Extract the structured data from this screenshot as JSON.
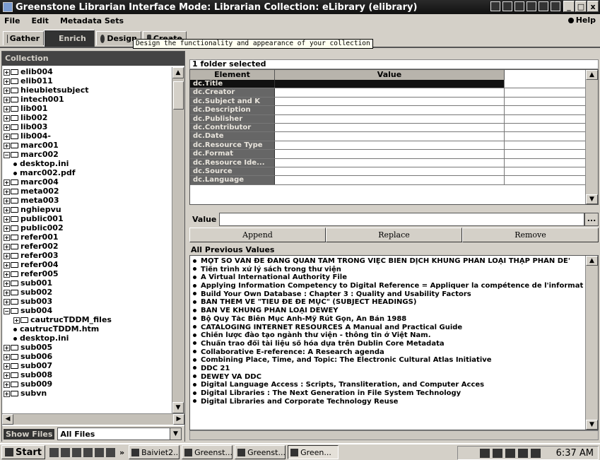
{
  "window": {
    "title": "Greenstone Librarian Interface  Mode: Librarian  Collection: eLibrary (elibrary)",
    "buttons": [
      "_",
      "□",
      "x"
    ]
  },
  "menu": {
    "items": [
      "File",
      "Edit",
      "Metadata Sets"
    ],
    "help": "Help"
  },
  "tabs": [
    {
      "label": "Gather",
      "icon": "gather-icon"
    },
    {
      "label": "Enrich",
      "icon": "enrich-icon"
    },
    {
      "label": "Design",
      "icon": "design-icon"
    },
    {
      "label": "Create",
      "icon": "create-icon"
    }
  ],
  "tooltip": "Design the functionality and appearance of your collection",
  "collection": {
    "header": "Collection",
    "tree": [
      {
        "label": "elib004",
        "type": "folder",
        "depth": 0
      },
      {
        "label": "elib011",
        "type": "folder",
        "depth": 0
      },
      {
        "label": "hieubietsubject",
        "type": "folder",
        "depth": 0
      },
      {
        "label": "intech001",
        "type": "folder",
        "depth": 0
      },
      {
        "label": "lib001",
        "type": "folder",
        "depth": 0
      },
      {
        "label": "lib002",
        "type": "folder",
        "depth": 0
      },
      {
        "label": "lib003",
        "type": "folder",
        "depth": 0
      },
      {
        "label": "lib004-",
        "type": "folder",
        "depth": 0
      },
      {
        "label": "marc001",
        "type": "folder",
        "depth": 0
      },
      {
        "label": "marc002",
        "type": "folder-open",
        "depth": 0
      },
      {
        "label": "desktop.ini",
        "type": "file",
        "depth": 1
      },
      {
        "label": "marc002.pdf",
        "type": "file",
        "depth": 1
      },
      {
        "label": "marc004",
        "type": "folder",
        "depth": 0
      },
      {
        "label": "meta002",
        "type": "folder",
        "depth": 0
      },
      {
        "label": "meta003",
        "type": "folder",
        "depth": 0
      },
      {
        "label": "nghiepvu",
        "type": "folder",
        "depth": 0
      },
      {
        "label": "public001",
        "type": "folder",
        "depth": 0
      },
      {
        "label": "public002",
        "type": "folder",
        "depth": 0
      },
      {
        "label": "refer001",
        "type": "folder",
        "depth": 0
      },
      {
        "label": "refer002",
        "type": "folder",
        "depth": 0
      },
      {
        "label": "refer003",
        "type": "folder",
        "depth": 0
      },
      {
        "label": "refer004",
        "type": "folder",
        "depth": 0
      },
      {
        "label": "refer005",
        "type": "folder",
        "depth": 0
      },
      {
        "label": "sub001",
        "type": "folder",
        "depth": 0
      },
      {
        "label": "sub002",
        "type": "folder",
        "depth": 0
      },
      {
        "label": "sub003",
        "type": "folder",
        "depth": 0
      },
      {
        "label": "sub004",
        "type": "folder-open",
        "depth": 0
      },
      {
        "label": "cautrucTDDM_files",
        "type": "folder",
        "depth": 1
      },
      {
        "label": "cautrucTDDM.htm",
        "type": "file",
        "depth": 1
      },
      {
        "label": "desktop.ini",
        "type": "file",
        "depth": 1
      },
      {
        "label": "sub005",
        "type": "folder",
        "depth": 0
      },
      {
        "label": "sub006",
        "type": "folder",
        "depth": 0
      },
      {
        "label": "sub007",
        "type": "folder",
        "depth": 0
      },
      {
        "label": "sub008",
        "type": "folder",
        "depth": 0
      },
      {
        "label": "sub009",
        "type": "folder",
        "depth": 0
      },
      {
        "label": "subvn",
        "type": "folder",
        "depth": 0
      }
    ],
    "show_files_label": "Show Files",
    "show_files_value": "All Files"
  },
  "selection_info": "1 folder selected",
  "metadata_table": {
    "columns": [
      "Element",
      "Value"
    ],
    "rows": [
      {
        "element": "dc.Title",
        "value": "",
        "selected": true
      },
      {
        "element": "dc.Creator",
        "value": ""
      },
      {
        "element": "dc.Subject and K",
        "value": ""
      },
      {
        "element": "dc.Description",
        "value": ""
      },
      {
        "element": "dc.Publisher",
        "value": ""
      },
      {
        "element": "dc.Contributor",
        "value": ""
      },
      {
        "element": "dc.Date",
        "value": ""
      },
      {
        "element": "dc.Resource Type",
        "value": ""
      },
      {
        "element": "dc.Format",
        "value": ""
      },
      {
        "element": "dc.Resource Ide...",
        "value": ""
      },
      {
        "element": "dc.Source",
        "value": ""
      },
      {
        "element": "dc.Language",
        "value": ""
      }
    ]
  },
  "value_field": {
    "label": "Value",
    "value": "",
    "more": "..."
  },
  "actions": [
    "Append",
    "Replace",
    "Remove"
  ],
  "previous_values": {
    "header": "All Previous Values",
    "items": [
      "MỘT SỐ VẤN ĐỀ ĐÁNG QUAN TÂM TRONG VIỆC BIÊN DỊCH  KHUNG PHÂN LOẠI THẬP PHÂN DE'",
      "Tiến trình xử lý sách trong thư viện",
      "A Virtual International Authority File",
      "Applying Information Competency to Digital Reference = Appliquer la compétence de l'informatio",
      "Build Your Own Database : Chapter 3 : Quality and Usability Factors",
      "BẢN THÊM VỀ \"TIÊU ĐỀ ĐỀ MỤC\" (SUBJECT HEADINGS)",
      "BÀN VỀ KHUNG PHÂN LOẠI DEWEY",
      "Bộ Quy Tắc Biên Mục Anh-Mỹ Rút Gọn, Ấn Bản 1988",
      "CATALOGING INTERNET RESOURCES A Manual and Practical Guide",
      "Chiến lược đào tạo ngành thư viện - thông tin ở Việt Nam.",
      "Chuẩn trao đổi tài liệu số hóa dựa trên Dublin Core Metadata",
      "Collaborative E-reference: A Research agenda",
      "Combining Place, Time, and Topic: The Electronic Cultural Atlas Initiative",
      "DDC 21",
      "DEWEY VÀ DDC",
      "Digital Language Access : Scripts, Transliteration, and Computer Acces",
      "Digital Libraries : The Next Generation in File System Technology",
      "Digital Libraries and Corporate Technology Reuse"
    ]
  },
  "taskbar": {
    "start": "Start",
    "tasks": [
      {
        "label": "Baiviet2...",
        "active": false
      },
      {
        "label": "Greenst...",
        "active": false
      },
      {
        "label": "Greenst...",
        "active": false
      },
      {
        "label": "Green...",
        "active": true
      }
    ],
    "clock": "6:37 AM"
  }
}
